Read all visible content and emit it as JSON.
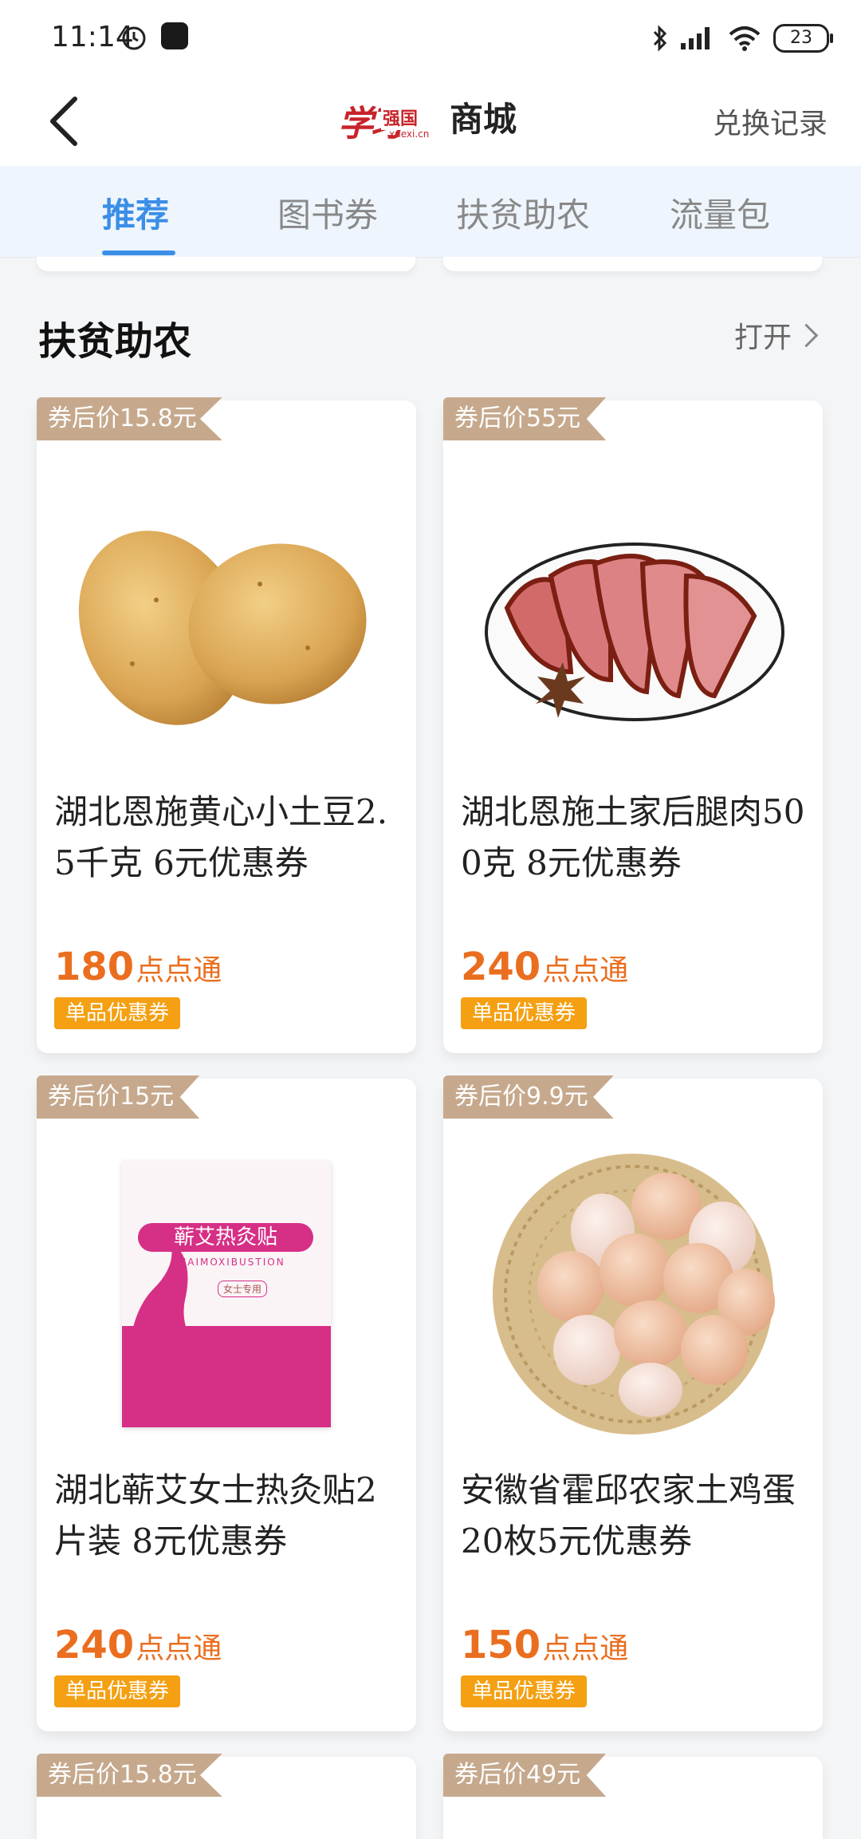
{
  "status": {
    "time": "11:14",
    "battery": "23"
  },
  "header": {
    "logo_script": "学习",
    "logo_sub": "强国",
    "logo_url": "xuexi.cn",
    "title": "商城",
    "right_link": "兑换记录"
  },
  "tabs": [
    {
      "label": "推荐",
      "active": true
    },
    {
      "label": "图书券",
      "active": false
    },
    {
      "label": "扶贫助农",
      "active": false
    },
    {
      "label": "流量包",
      "active": false
    }
  ],
  "section": {
    "title": "扶贫助农",
    "more": "打开"
  },
  "products": [
    {
      "price_tag": "券后价15.8元",
      "name": "湖北恩施黄心小土豆2.5千克 6元优惠券",
      "points": "180",
      "points_unit": "点点通",
      "badge": "单品优惠券",
      "image": "potato"
    },
    {
      "price_tag": "券后价55元",
      "name": "湖北恩施土家后腿肉500克 8元优惠券",
      "points": "240",
      "points_unit": "点点通",
      "badge": "单品优惠券",
      "image": "bacon"
    },
    {
      "price_tag": "券后价15元",
      "name": "湖北蕲艾女士热灸贴2片装 8元优惠券",
      "points": "240",
      "points_unit": "点点通",
      "badge": "单品优惠券",
      "image": "moxa-box"
    },
    {
      "price_tag": "券后价9.9元",
      "name": "安徽省霍邱农家土鸡蛋20枚5元优惠券",
      "points": "150",
      "points_unit": "点点通",
      "badge": "单品优惠券",
      "image": "eggs"
    }
  ],
  "next_row_tags": [
    "券后价15.8元",
    "券后价49元"
  ],
  "moxa_box": {
    "title": "蕲艾热灸贴",
    "subtitle": "QIAIMOXIBUSTION",
    "note": "女士专用"
  }
}
